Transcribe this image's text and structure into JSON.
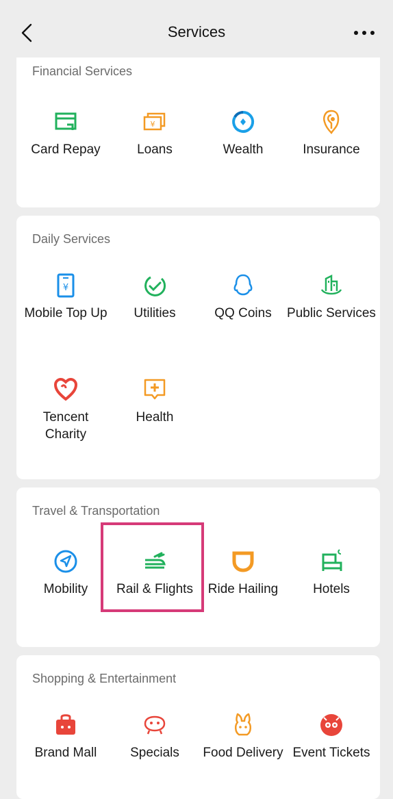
{
  "header": {
    "title": "Services",
    "back_icon": "chevron-left-icon",
    "more_icon": "more-dots-icon"
  },
  "sections": [
    {
      "title": "Financial Services",
      "items": [
        {
          "label": "Card Repay",
          "icon": "card-repay-icon",
          "color": "#21b15c"
        },
        {
          "label": "Loans",
          "icon": "loans-icon",
          "color": "#f39a24"
        },
        {
          "label": "Wealth",
          "icon": "wealth-icon",
          "color": "#1aa0e8"
        },
        {
          "label": "Insurance",
          "icon": "insurance-icon",
          "color": "#f39a24"
        }
      ]
    },
    {
      "title": "Daily Services",
      "items": [
        {
          "label": "Mobile Top Up",
          "icon": "mobile-topup-icon",
          "color": "#1a8fe8"
        },
        {
          "label": "Utilities",
          "icon": "utilities-icon",
          "color": "#21b15c"
        },
        {
          "label": "QQ Coins",
          "icon": "qq-coins-icon",
          "color": "#1a8fe8"
        },
        {
          "label": "Public Services",
          "icon": "public-services-icon",
          "color": "#21b15c"
        },
        {
          "label": "Tencent Charity",
          "icon": "charity-icon",
          "color": "#e8453a"
        },
        {
          "label": "Health",
          "icon": "health-icon",
          "color": "#f39a24"
        }
      ]
    },
    {
      "title": "Travel & Transportation",
      "items": [
        {
          "label": "Mobility",
          "icon": "mobility-icon",
          "color": "#1a8fe8"
        },
        {
          "label": "Rail & Flights",
          "icon": "rail-flights-icon",
          "color": "#21b15c"
        },
        {
          "label": "Ride Hailing",
          "icon": "ride-hailing-icon",
          "color": "#f39a24"
        },
        {
          "label": "Hotels",
          "icon": "hotels-icon",
          "color": "#21b15c"
        }
      ]
    },
    {
      "title": "Shopping & Entertainment",
      "items": [
        {
          "label": "Brand Mall",
          "icon": "brand-mall-icon",
          "color": "#e8453a"
        },
        {
          "label": "Specials",
          "icon": "specials-icon",
          "color": "#e8453a"
        },
        {
          "label": "Food Delivery",
          "icon": "food-delivery-icon",
          "color": "#f39a24"
        },
        {
          "label": "Event Tickets",
          "icon": "event-tickets-icon",
          "color": "#e8453a"
        }
      ]
    }
  ]
}
